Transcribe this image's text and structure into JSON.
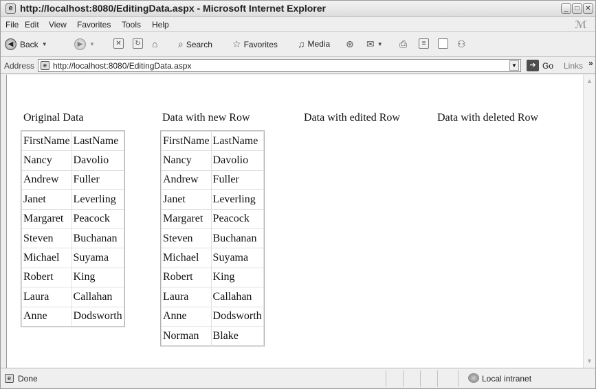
{
  "window": {
    "title": "http://localhost:8080/EditingData.aspx - Microsoft Internet Explorer"
  },
  "menu": {
    "items": [
      "File",
      "Edit",
      "View",
      "Favorites",
      "Tools",
      "Help"
    ]
  },
  "toolbar": {
    "back_label": "Back",
    "search_label": "Search",
    "favorites_label": "Favorites",
    "media_label": "Media"
  },
  "address": {
    "label": "Address",
    "url": "http://localhost:8080/EditingData.aspx",
    "go_label": "Go",
    "links_label": "Links"
  },
  "page": {
    "sections": [
      {
        "title": "Original Data",
        "columns": [
          "FirstName",
          "LastName"
        ],
        "rows": [
          [
            "Nancy",
            "Davolio"
          ],
          [
            "Andrew",
            "Fuller"
          ],
          [
            "Janet",
            "Leverling"
          ],
          [
            "Margaret",
            "Peacock"
          ],
          [
            "Steven",
            "Buchanan"
          ],
          [
            "Michael",
            "Suyama"
          ],
          [
            "Robert",
            "King"
          ],
          [
            "Laura",
            "Callahan"
          ],
          [
            "Anne",
            "Dodsworth"
          ]
        ]
      },
      {
        "title": "Data with new Row",
        "columns": [
          "FirstName",
          "LastName"
        ],
        "rows": [
          [
            "Nancy",
            "Davolio"
          ],
          [
            "Andrew",
            "Fuller"
          ],
          [
            "Janet",
            "Leverling"
          ],
          [
            "Margaret",
            "Peacock"
          ],
          [
            "Steven",
            "Buchanan"
          ],
          [
            "Michael",
            "Suyama"
          ],
          [
            "Robert",
            "King"
          ],
          [
            "Laura",
            "Callahan"
          ],
          [
            "Anne",
            "Dodsworth"
          ],
          [
            "Norman",
            "Blake"
          ]
        ]
      },
      {
        "title": "Data with edited Row"
      },
      {
        "title": "Data with deleted Row"
      }
    ]
  },
  "status": {
    "text": "Done",
    "zone": "Local intranet"
  }
}
